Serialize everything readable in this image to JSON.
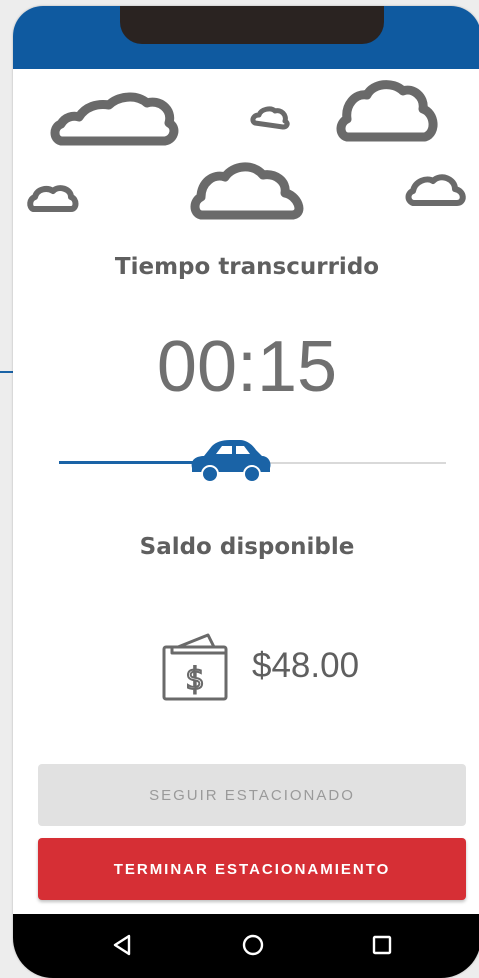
{
  "status": {
    "elapsed_label": "Tiempo transcurrido",
    "elapsed_value": "00:15",
    "progress_fraction": 0.44
  },
  "balance": {
    "label": "Saldo disponible",
    "amount": "$48.00",
    "icon": "wallet-dollar-icon"
  },
  "actions": {
    "continue_label": "SEGUIR ESTACIONADO",
    "end_label": "TERMINAR ESTACIONAMIENTO"
  },
  "navigation": {
    "back": "back-triangle-icon",
    "home": "home-circle-icon",
    "recents": "recents-square-icon"
  },
  "colors": {
    "brand_blue": "#0f5aa0",
    "accent_blue": "#1a63a6",
    "danger_red": "#d62f35",
    "text_gray": "#5f5f5f"
  }
}
